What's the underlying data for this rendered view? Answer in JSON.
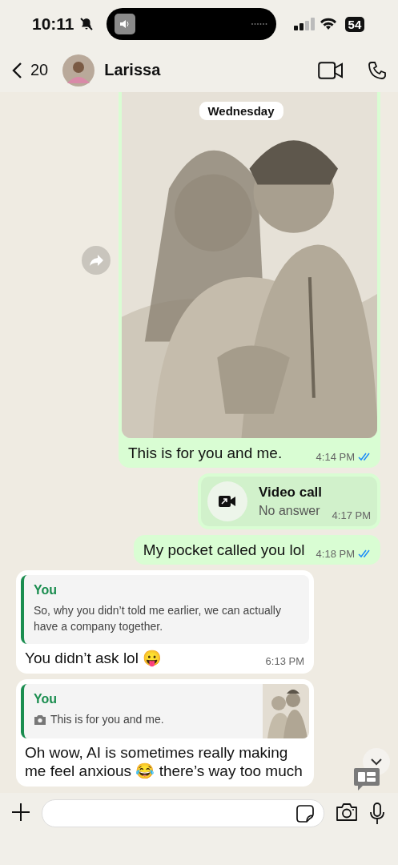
{
  "status_bar": {
    "time": "10:11",
    "battery": "54"
  },
  "header": {
    "back_count": "20",
    "name": "Larissa"
  },
  "date_pill": "Wednesday",
  "messages": [
    {
      "outgoing": true,
      "text": "This is for you and me.",
      "time": "4:14 PM",
      "read": true
    },
    {
      "kind": "call",
      "outgoing": true,
      "title": "Video call",
      "subtitle": "No answer",
      "time": "4:17 PM"
    },
    {
      "kind": "text",
      "outgoing": true,
      "text": "My pocket called you lol",
      "time": "4:18 PM",
      "read": true
    },
    {
      "kind": "reply",
      "outgoing": false,
      "quote_author": "You",
      "quote_text": "So, why you didn’t told me earlier, we can actually have a company together.",
      "text": "You didn’t ask lol 😛",
      "time": "6:13 PM"
    },
    {
      "kind": "reply_photo",
      "outgoing": false,
      "quote_author": "You",
      "quote_text": "This is for you and me.",
      "text": "Oh wow, AI is sometimes really making me feel anxious 😂 there’s way too much"
    }
  ]
}
